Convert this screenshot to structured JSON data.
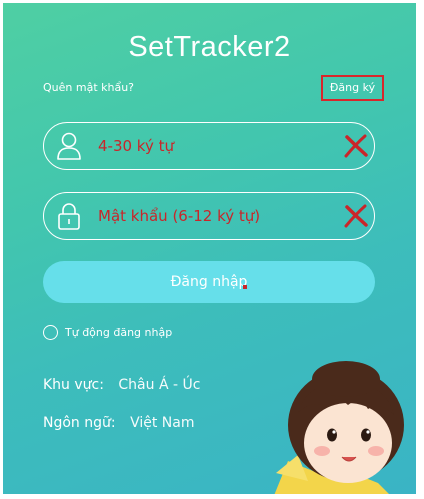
{
  "app": {
    "title": "SetTracker2"
  },
  "links": {
    "forgot_password": "Quên mật khẩu?",
    "register": "Đăng ký"
  },
  "form": {
    "username_placeholder": "4-30 ký tự",
    "password_placeholder": "Mật khẩu (6-12 ký tự)",
    "login_button": "Đăng nhập",
    "auto_login_label": "Tự động đăng nhập",
    "auto_login_checked": false
  },
  "settings": {
    "region_label": "Khu vực:",
    "region_value": "Châu Á - Úc",
    "language_label": "Ngôn ngữ:",
    "language_value": "Việt Nam"
  },
  "icons": {
    "user": "user-icon",
    "lock": "lock-icon",
    "clear": "red-x-clear-icon"
  },
  "colors": {
    "background_top": "#4fcfa3",
    "background_bottom": "#3ab4c5",
    "login_button": "#66dfea",
    "placeholder_text": "#c9262a",
    "highlight_box": "#d9262b"
  }
}
